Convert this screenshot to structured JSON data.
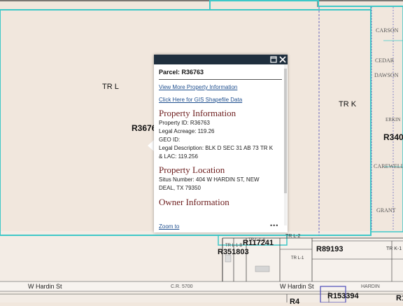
{
  "map": {
    "tract_labels": [
      "TR L",
      "TR K",
      "TR L-2",
      "TR K-1",
      "TR L-1-A",
      "TR L-1-B",
      "TR L-1"
    ],
    "parcel_labels": [
      "R3676",
      "R340",
      "R351803",
      "R117241",
      "R89193",
      "R153394",
      "R4",
      "R1"
    ],
    "street_labels": [
      "W Hardin St",
      "C.R. 5700",
      "W Hardin St",
      "HARDIN"
    ],
    "vertical_streets": [
      "CARSON",
      "CEDAR",
      "DAWSON",
      "ERKIN",
      "CAREWELL",
      "GRANT"
    ],
    "colors": {
      "background": "#f1e7dd",
      "parcel_highlight": "#3ec8c8",
      "boundary": "#333333",
      "dashed_line": "#4a4ab8"
    }
  },
  "popup": {
    "title": "Parcel: R36763",
    "links": [
      "View More Property Information",
      "Click Here for GIS Shapefile Data"
    ],
    "property_info": {
      "heading": "Property Information",
      "lines": [
        "Property ID: R36763",
        "Legal Acreage: 119.26",
        "GEO ID:",
        "Legal Description: BLK D SEC 31 AB 73 TR K",
        "& LAC: 119.256"
      ]
    },
    "property_location": {
      "heading": "Property Location",
      "lines": [
        "Situs Number: 404 W HARDIN ST, NEW",
        "DEAL, TX 79350"
      ]
    },
    "owner": {
      "heading": "Owner Information"
    },
    "zoom_label": "Zoom to",
    "more_label": "•••",
    "maximize_icon": "maximize-icon",
    "close_icon": "close-icon"
  }
}
